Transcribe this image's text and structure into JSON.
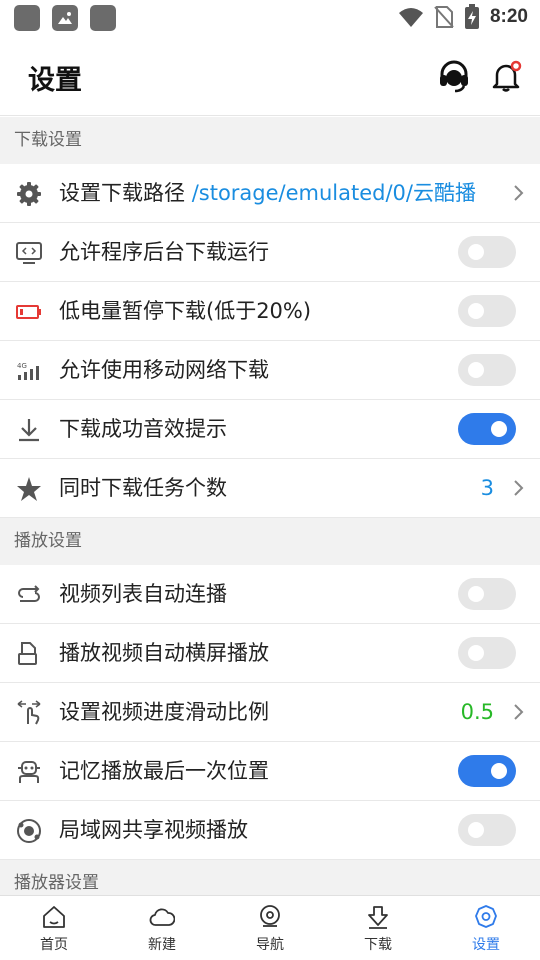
{
  "status_bar": {
    "time": "8:20"
  },
  "header": {
    "title": "设置"
  },
  "sections": [
    {
      "title": "下载设置",
      "items": [
        {
          "label": "设置下载路径",
          "path": "/storage/emulated/0/云酷播"
        },
        {
          "label": "允许程序后台下载运行",
          "toggle": false
        },
        {
          "label": "低电量暂停下载(低于20%)",
          "toggle": false
        },
        {
          "label": "允许使用移动网络下载",
          "toggle": false
        },
        {
          "label": "下载成功音效提示",
          "toggle": true
        },
        {
          "label": "同时下载任务个数",
          "value": "3"
        }
      ]
    },
    {
      "title": "播放设置",
      "items": [
        {
          "label": "视频列表自动连播",
          "toggle": false
        },
        {
          "label": "播放视频自动横屏播放",
          "toggle": false
        },
        {
          "label": "设置视频进度滑动比例",
          "value": "0.5"
        },
        {
          "label": "记忆播放最后一次位置",
          "toggle": true
        },
        {
          "label": "局域网共享视频播放",
          "toggle": false
        }
      ]
    },
    {
      "title": "播放器设置"
    }
  ],
  "bottom_nav": [
    {
      "label": "首页",
      "icon": "home-icon",
      "active": false
    },
    {
      "label": "新建",
      "icon": "cloud-icon",
      "active": false
    },
    {
      "label": "导航",
      "icon": "compass-icon",
      "active": false
    },
    {
      "label": "下载",
      "icon": "download-icon",
      "active": false
    },
    {
      "label": "设置",
      "icon": "gear-icon",
      "active": true
    }
  ],
  "colors": {
    "accent": "#2f7bea",
    "path": "#1a8de0",
    "task_count": "#1a8de0",
    "progress_ratio": "#27b827",
    "section_bg": "#f2f2f2"
  }
}
